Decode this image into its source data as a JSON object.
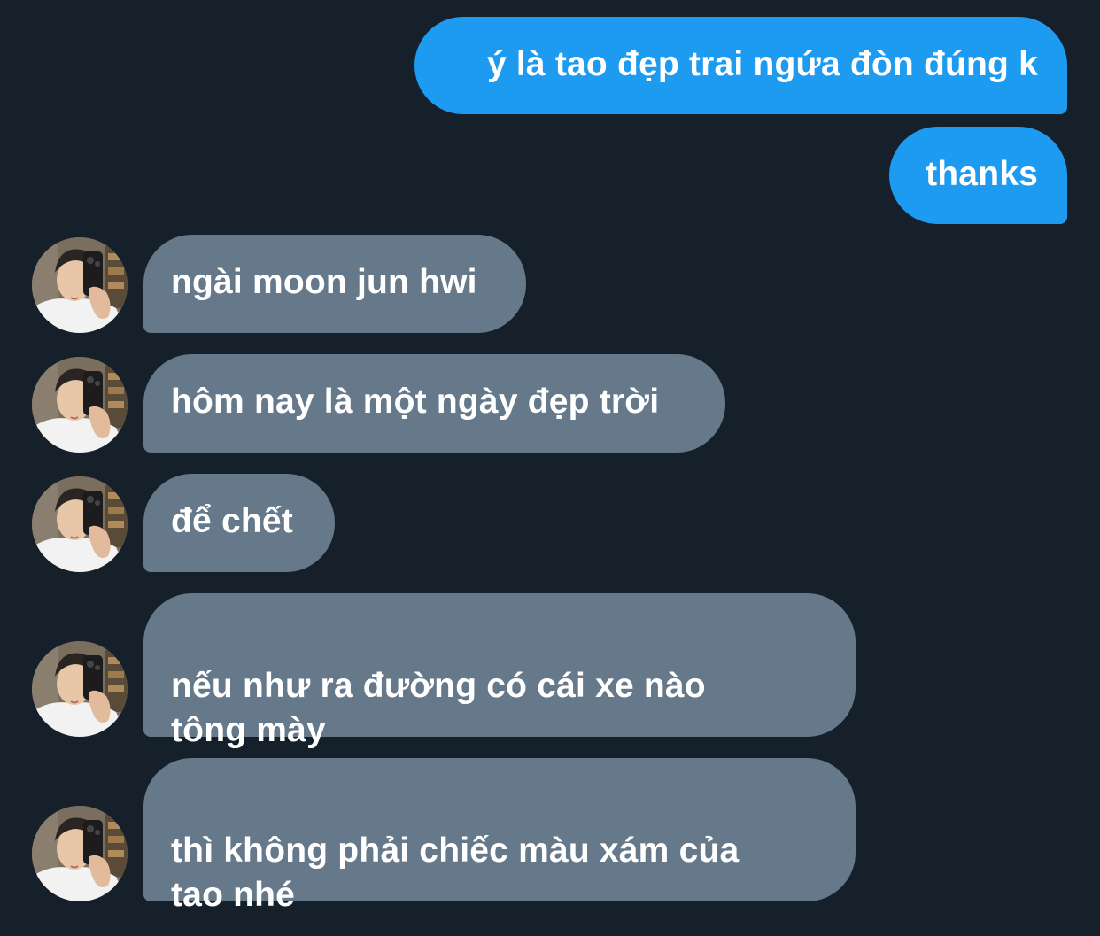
{
  "conversation": {
    "messages": [
      {
        "direction": "sent",
        "text": "ý là tao đẹp trai ngứa đòn đúng k"
      },
      {
        "direction": "sent",
        "text": "thanks"
      },
      {
        "direction": "received",
        "text": "ngài moon jun hwi",
        "avatar_icon": "profile-photo"
      },
      {
        "direction": "received",
        "text": "hôm nay là một ngày đẹp trời",
        "avatar_icon": "profile-photo"
      },
      {
        "direction": "received",
        "text": "để chết",
        "avatar_icon": "profile-photo"
      },
      {
        "direction": "received",
        "text": "nếu như ra đường có cái xe nào\ntông mày",
        "avatar_icon": "profile-photo"
      },
      {
        "direction": "received",
        "text": "thì không phải chiếc màu xám của\ntao nhé",
        "avatar_icon": "profile-photo"
      }
    ]
  },
  "colors": {
    "background": "#15202b",
    "sent_bubble": "#1d9bf0",
    "received_bubble": "#66798a",
    "text": "#ffffff"
  }
}
